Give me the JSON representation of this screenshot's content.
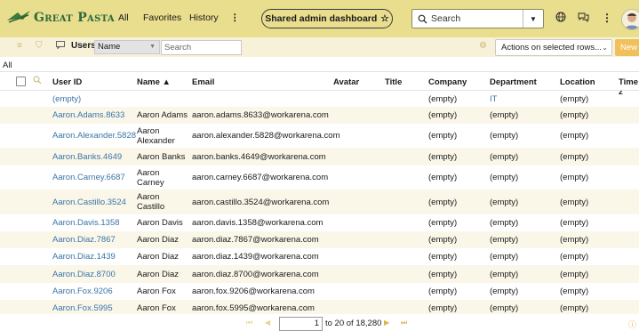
{
  "banner": {
    "logo_text": "Great Pasta",
    "nav": [
      "All",
      "Favorites",
      "History"
    ],
    "more_label": "⋮",
    "dashboard_label": "Shared admin dashboard",
    "star_icon": "☆",
    "search_placeholder": "Search"
  },
  "toolbar": {
    "list_title": "Users",
    "field_select": "Name",
    "search_placeholder": "Search",
    "actions_label": "Actions on selected rows...",
    "new_label": "New"
  },
  "breadcrumb": "All",
  "columns": [
    "User ID",
    "Name ▲",
    "Email",
    "Avatar",
    "Title",
    "Company",
    "Department",
    "Location",
    "Time z"
  ],
  "rows": [
    {
      "user_id": "(empty)",
      "name": "",
      "email": "",
      "company": "(empty)",
      "department": "IT",
      "location": "(empty)",
      "dept_link": true
    },
    {
      "user_id": "Aaron.Adams.8633",
      "name": "Aaron Adams",
      "email": "aaron.adams.8633@workarena.com",
      "company": "(empty)",
      "department": "(empty)",
      "location": "(empty)"
    },
    {
      "user_id": "Aaron.Alexander.5828",
      "name": "Aaron\nAlexander",
      "email": "aaron.alexander.5828@workarena.com",
      "company": "(empty)",
      "department": "(empty)",
      "location": "(empty)"
    },
    {
      "user_id": "Aaron.Banks.4649",
      "name": "Aaron Banks",
      "email": "aaron.banks.4649@workarena.com",
      "company": "(empty)",
      "department": "(empty)",
      "location": "(empty)"
    },
    {
      "user_id": "Aaron.Carney.6687",
      "name": "Aaron\nCarney",
      "email": "aaron.carney.6687@workarena.com",
      "company": "(empty)",
      "department": "(empty)",
      "location": "(empty)"
    },
    {
      "user_id": "Aaron.Castillo.3524",
      "name": "Aaron\nCastillo",
      "email": "aaron.castillo.3524@workarena.com",
      "company": "(empty)",
      "department": "(empty)",
      "location": "(empty)"
    },
    {
      "user_id": "Aaron.Davis.1358",
      "name": "Aaron Davis",
      "email": "aaron.davis.1358@workarena.com",
      "company": "(empty)",
      "department": "(empty)",
      "location": "(empty)"
    },
    {
      "user_id": "Aaron.Diaz.7867",
      "name": "Aaron Diaz",
      "email": "aaron.diaz.7867@workarena.com",
      "company": "(empty)",
      "department": "(empty)",
      "location": "(empty)"
    },
    {
      "user_id": "Aaron.Diaz.1439",
      "name": "Aaron Diaz",
      "email": "aaron.diaz.1439@workarena.com",
      "company": "(empty)",
      "department": "(empty)",
      "location": "(empty)"
    },
    {
      "user_id": "Aaron.Diaz.8700",
      "name": "Aaron Diaz",
      "email": "aaron.diaz.8700@workarena.com",
      "company": "(empty)",
      "department": "(empty)",
      "location": "(empty)"
    },
    {
      "user_id": "Aaron.Fox.9206",
      "name": "Aaron Fox",
      "email": "aaron.fox.9206@workarena.com",
      "company": "(empty)",
      "department": "(empty)",
      "location": "(empty)"
    },
    {
      "user_id": "Aaron.Fox.5995",
      "name": "Aaron Fox",
      "email": "aaron.fox.5995@workarena.com",
      "company": "(empty)",
      "department": "(empty)",
      "location": "(empty)"
    }
  ],
  "pager": {
    "page": "1",
    "range_text": "to 20 of 18,280"
  },
  "colors": {
    "banner": "#e9dd8e",
    "toolbar": "#f6f1d7",
    "link": "#3a74a8",
    "accent": "#f0c05a"
  }
}
